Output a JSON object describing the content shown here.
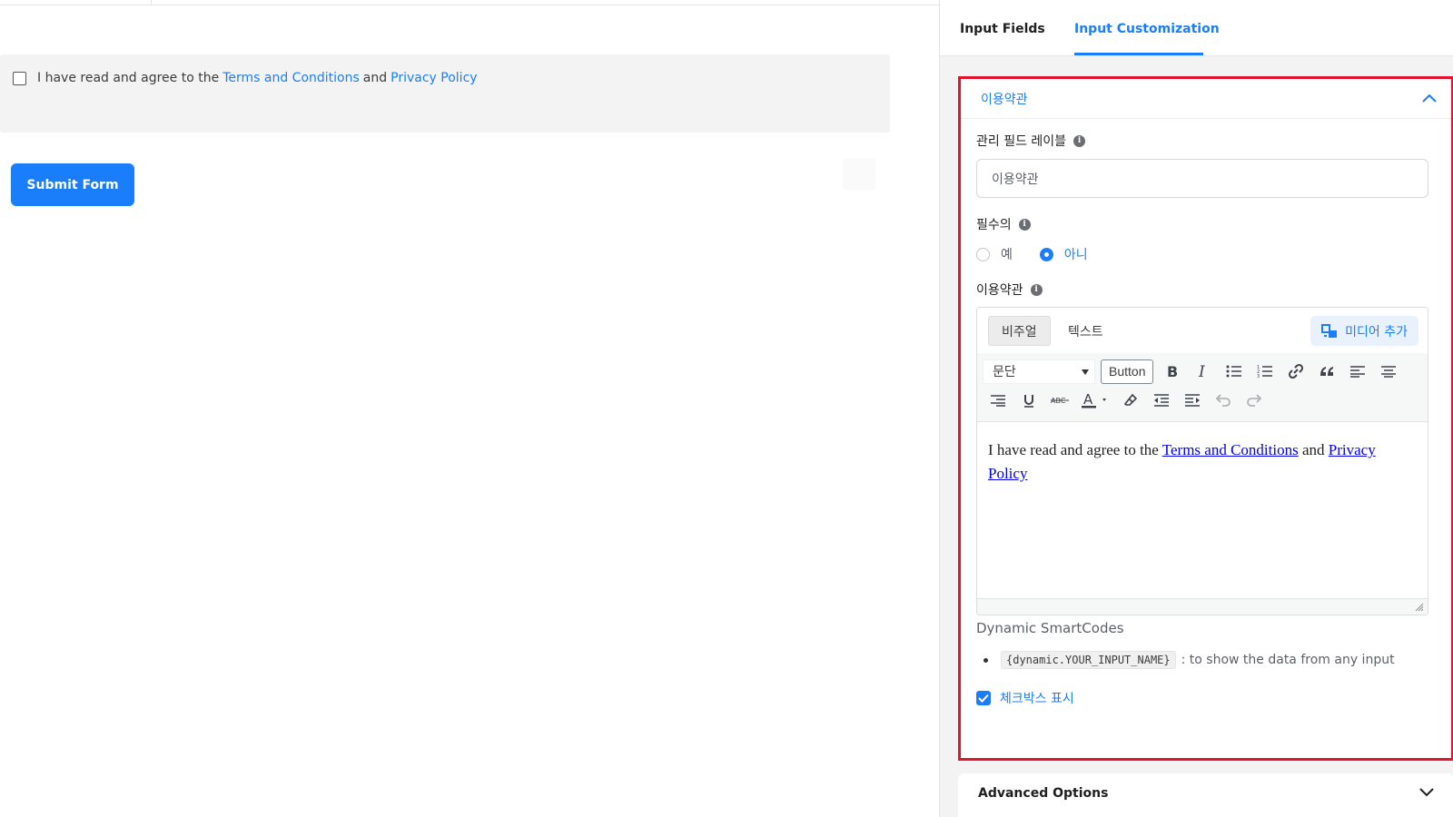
{
  "preview": {
    "consent_prefix": "I have read and agree to the",
    "terms_link": "Terms and Conditions",
    "conj": "and",
    "privacy_link": "Privacy Policy",
    "submit_label": "Submit Form"
  },
  "panel": {
    "tabs": [
      {
        "label": "Input Fields",
        "active": false
      },
      {
        "label": "Input Customization",
        "active": true
      }
    ],
    "section": {
      "title": "이용약관",
      "admin_label": "관리 필드 레이블",
      "admin_value": "이용약관",
      "required_label": "필수의",
      "required_options": [
        {
          "label": "예",
          "selected": false
        },
        {
          "label": "아니",
          "selected": true
        }
      ],
      "terms_label": "이용약관",
      "editor": {
        "tab_visual": "비주얼",
        "tab_text": "텍스트",
        "media_button": "미디어 추가",
        "format_select": "문단",
        "button_tag": "Button",
        "content_prefix": "I have read and agree to the",
        "content_link1": "Terms and Conditions",
        "content_conj": "and",
        "content_link2": "Privacy Policy"
      },
      "smartcodes_title": "Dynamic SmartCodes",
      "smartcode_code": "{dynamic.YOUR_INPUT_NAME}",
      "smartcode_desc": ": to show the data from any input",
      "show_checkbox_label": "체크박스 표시",
      "show_checkbox_checked": true
    },
    "advanced_title": "Advanced Options"
  },
  "colors": {
    "accent": "#1a7efb",
    "highlight_border": "#e0142e",
    "panel_bg": "#f3f3f3"
  },
  "icons": [
    "info-icon",
    "chevron-up-icon",
    "chevron-down-icon",
    "media-icon",
    "bold-icon",
    "italic-icon",
    "bullet-list-icon",
    "numbered-list-icon",
    "link-icon",
    "blockquote-icon",
    "align-left-icon",
    "align-center-icon",
    "align-right-icon",
    "underline-icon",
    "strikethrough-icon",
    "text-color-icon",
    "clear-formatting-icon",
    "outdent-icon",
    "indent-icon",
    "undo-icon",
    "redo-icon",
    "check-icon"
  ]
}
